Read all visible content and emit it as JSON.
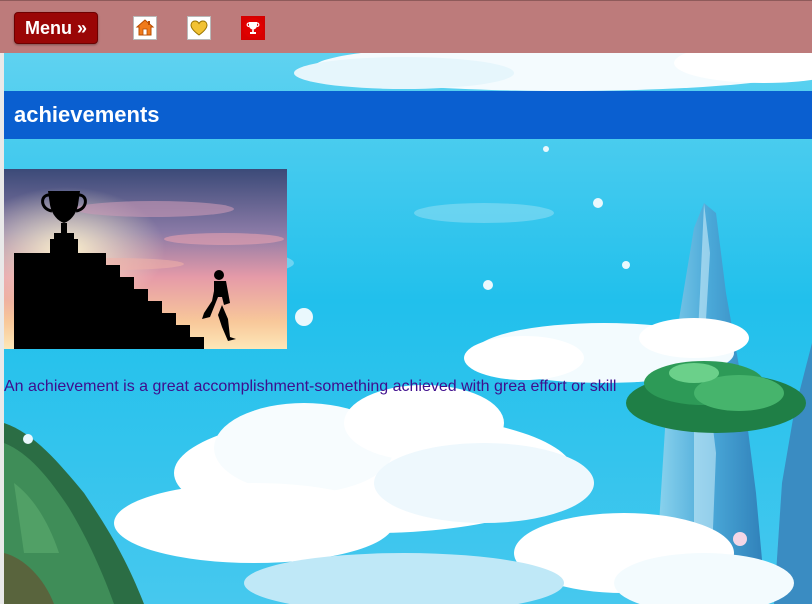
{
  "topbar": {
    "menu_label": "Menu »",
    "icons": [
      "home-icon",
      "heart-icon",
      "trophy-icon"
    ]
  },
  "header": {
    "title": "achievements"
  },
  "hero": {
    "image": "trophy-staircase-silhouette"
  },
  "content": {
    "description": "An achievement is a great accomplishment-something achieved with grea effort or skill"
  },
  "colors": {
    "topbar": "#bd7b7b",
    "menu_button": "#9a0606",
    "title_band": "#0a5fd0",
    "description_text": "#3f0e8d",
    "sky": "#2fc6ee"
  }
}
